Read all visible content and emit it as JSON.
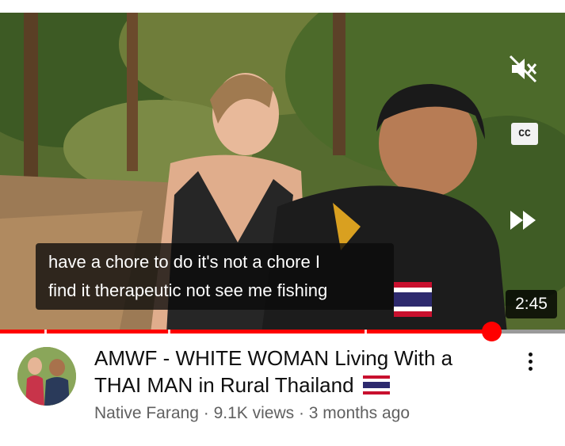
{
  "video": {
    "captions": [
      "have a chore to do it's not a chore I",
      "find it therapeutic not see me fishing"
    ],
    "duration": "2:45",
    "progress_fraction": 0.87,
    "controls": {
      "mute_icon": "muted-speaker-icon",
      "cc_label": "CC",
      "forward_icon": "fast-forward-icon"
    }
  },
  "details": {
    "title": "AMWF - WHITE WOMAN Living With a THAI MAN in Rural Thailand",
    "title_flag": "thailand-flag-icon",
    "channel": "Native Farang",
    "views": "9.1K views",
    "age": "3 months ago",
    "separator": " · "
  },
  "colors": {
    "progress": "#ff0000",
    "track": "#9a9a9a",
    "meta_text": "#606060"
  }
}
